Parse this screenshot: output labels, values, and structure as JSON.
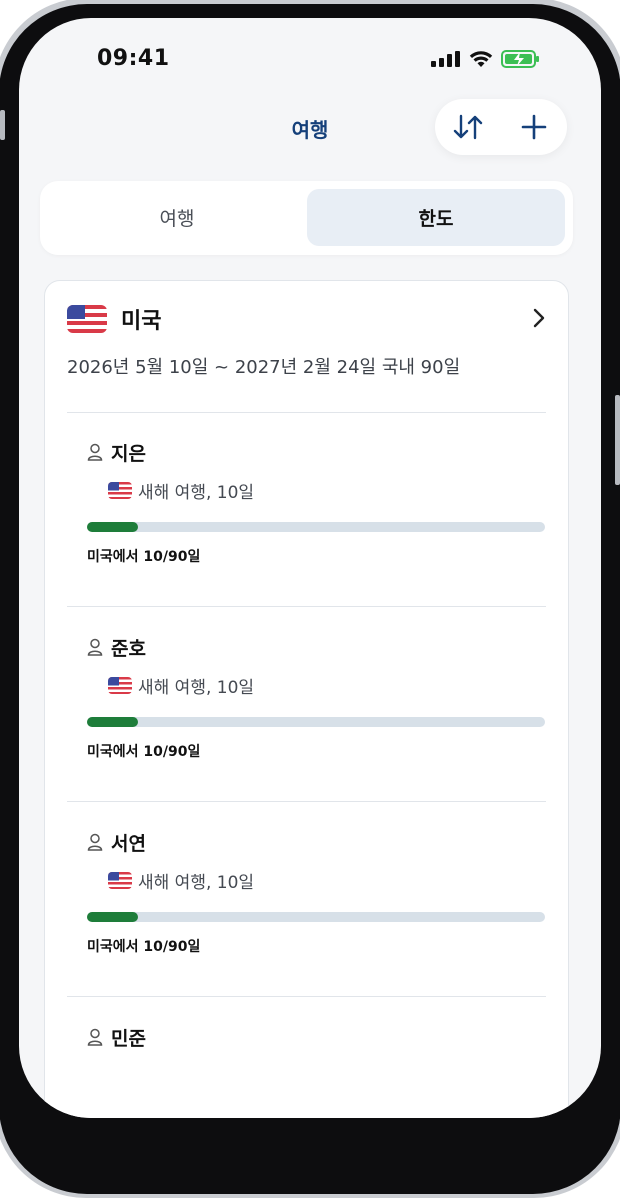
{
  "status_bar": {
    "time": "09:41",
    "icons": [
      "signal-icon",
      "wifi-icon",
      "battery-charging-icon"
    ]
  },
  "nav": {
    "title": "여행",
    "sort_icon": "sort-arrows-icon",
    "add_icon": "plus-icon"
  },
  "segment": {
    "tabs": [
      {
        "label": "여행",
        "selected": false
      },
      {
        "label": "한도",
        "selected": true
      }
    ]
  },
  "card": {
    "country": "미국",
    "flag": "us-flag-icon",
    "date_range": "2026년 5월 10일 ~ 2027년 2월 24일 국내 90일",
    "travelers": [
      {
        "name": "지은",
        "trip": "새해 여행, 10일",
        "used": 10,
        "limit": 90,
        "usage_text": "미국에서 10/90일"
      },
      {
        "name": "준호",
        "trip": "새해 여행, 10일",
        "used": 10,
        "limit": 90,
        "usage_text": "미국에서 10/90일"
      },
      {
        "name": "서연",
        "trip": "새해 여행, 10일",
        "used": 10,
        "limit": 90,
        "usage_text": "미국에서 10/90일"
      },
      {
        "name": "민준"
      }
    ]
  },
  "colors": {
    "accent": "#15407a",
    "progress": "#1e7d3a",
    "track": "#d7e0e8",
    "selected_tab": "#e8eef5"
  }
}
